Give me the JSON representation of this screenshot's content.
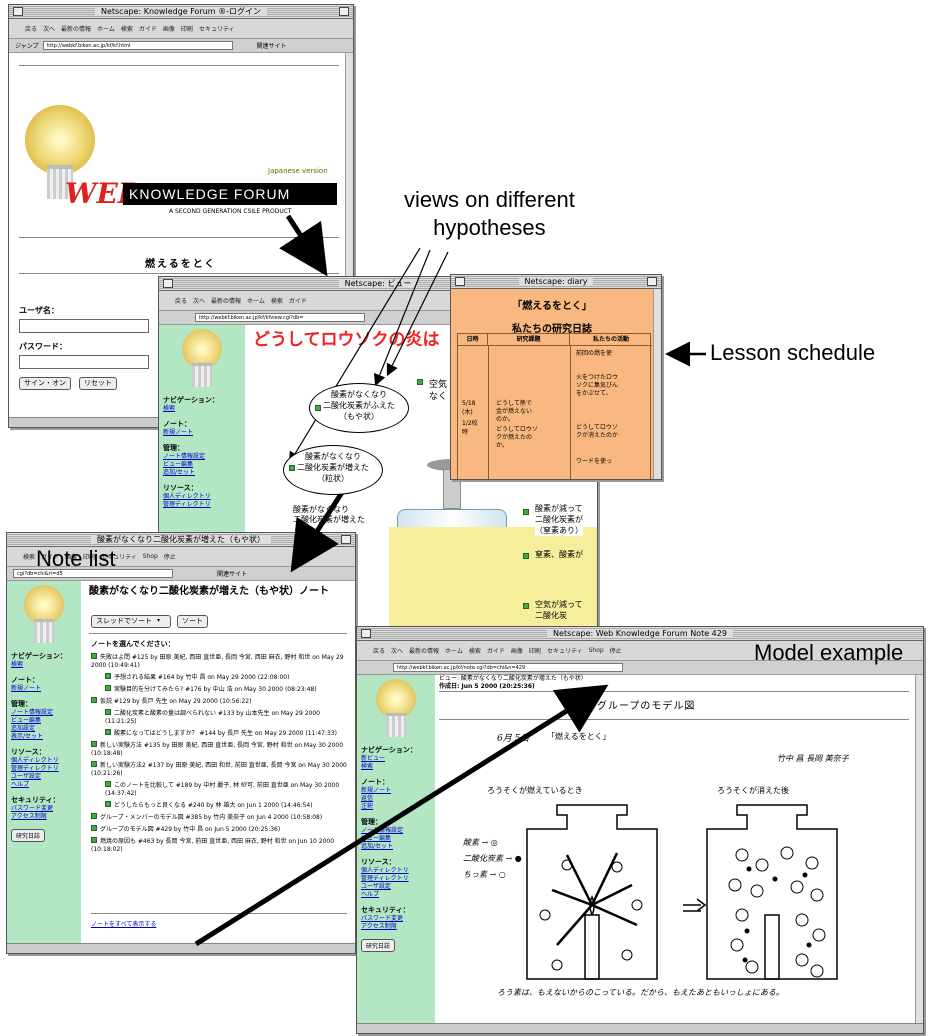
{
  "captions": {
    "views": "views on different\nhypotheses",
    "lesson": "Lesson schedule",
    "notelist": "Note list",
    "model": "Model example"
  },
  "login_window": {
    "title": "Netscape: Knowledge Forum ®-ログイン",
    "toolbar": [
      "戻る",
      "次へ",
      "最新の情報",
      "ホーム",
      "検索",
      "ガイド",
      "画像",
      "印刷",
      "セキュリティ"
    ],
    "location_label": "ジャンプ",
    "url": "http://webkf.biken.ac.jp/kf/kf.html",
    "related": "関連サイト",
    "version": "Japanese version",
    "brand_web": "WEB",
    "brand_kf": "KNOWLEDGE FORUM",
    "brand_sub": "A SECOND GENERATION CSILE PRODUCT",
    "database": "燃えるをとく",
    "user_label": "ユーザ名：",
    "password_label": "パスワード：",
    "signin_button": "サイン・オン",
    "reset_button": "リセット"
  },
  "view_window": {
    "title": "Netscape: ビュー",
    "url": "http://webkf.biken.ac.jp/kf/kfview.cgi?db=",
    "heading": "どうしてロウソクの炎は",
    "bubble1": "酸素がなくなり\n二酸化炭素がふえた\n（もや状）",
    "bubble2": "酸素がなくなり\n二酸化炭素が増えた\n（粒状）",
    "note3": "酸素がなくなり\n二酸化炭素が増えた",
    "note_right1": "空気",
    "note_right2": "なく",
    "note_right3": "酸素が減って\n二酸化炭素が\n（窒素あり）",
    "note_right4": "窒素、酸素が",
    "note_right5": "空気が減って\n二酸化炭",
    "nav_title": "ナビゲーション：",
    "nav_links": [
      "検索"
    ],
    "notes_title": "ノート：",
    "notes_links": [
      "新規ノート"
    ],
    "manage_title": "管理：",
    "manage_links": [
      "ノート情報設定",
      "ビュー編集",
      "追加/セット"
    ],
    "source_title": "リソース：",
    "source_links": [
      "個人ディレクトリ",
      "管理ディレクトリ"
    ]
  },
  "diary_window": {
    "title": "Netscape: diary",
    "heading1": "「燃えるをとく」",
    "heading2": "私たちの研究日誌",
    "col1": "日時",
    "col2": "研究課題",
    "col3": "私たちの活動",
    "date1": "5/18\n(木)",
    "date2": "1/2校\n時",
    "topic1": "どうして熱で\n金が燃えない\nのか。",
    "topic2": "どうしてロウソ\nクが燃えたの\nか。",
    "act1": "前回の燃を使",
    "act2": "火をつけたロウ\nソクに集気びん\nをかぶせて、",
    "act3": "どうしてロウソ\nクが消えたのか",
    "act4": "ワードを使っ"
  },
  "notelist_window": {
    "title": "酸素がなくなり二酸化炭素が増えた（もや状）",
    "url": "cgi?db=chi&ri=d5",
    "related": "関連サイト",
    "heading": "酸素がなくなり二酸化炭素が増えた（もや状）ノート",
    "select_value": "スレッドでソート",
    "sort_button": "ソート",
    "prompt": "ノートを選んでください：",
    "items": [
      "失敗はよ問 #125 by 田原 美紀, 西田 直世亜, 長岡 今宮, 西田 麻衣, 野村 和世 on May 29 2000 (10:49:41)",
      "予想される結果 #164 by 竹中 昌 on May 29 2000 (22:08:00)",
      "実験目的を分けてみたら? #176 by 中山 浩 on May 30 2000 (08:23:48)",
      "仮説 #129 by 長戸 先生 on May 29 2000 (10:56:22)",
      "二酸化炭素と酸素の量は調べられない #133 by 山本先生 on May 29 2000 (11:21:25)",
      "酸素になってはどうしますか？ #144 by 長戸 先生 on May 29 2000 (11:47:33)",
      "新しい実験方法 #135 by 田原 美紀, 西田 直世亜, 長岡 今宮, 野村 和世 on May 30 2000 (10:18:48)",
      "新しい実験方法2 #137 by 田原 美紀, 西田 和世, 前田 直世亜, 長岡 今宮 on May 30 2000 (10:21:26)",
      "このノートを比較して #189 by 中村 麗子, 林 紗可, 前田 直世亜 on May 30 2000 (14:37:42)",
      "どうしたらもっと良くなる #240 by 林 雄大 on Jun 1 2000 (14:46:54)",
      "グループ・メンバーのモデル図 #385 by 竹内 美奈子 on Jun 4 2000 (10:58:08)",
      "グループのモデル図 #429 by 竹中 昌 on Jun 5 2000 (20:25:36)",
      "燃焼の原因も #463 by 長岡 今宮, 前田 直世亜, 西田 麻衣, 野村 和世 on Jun 10 2000 (10:18:02)"
    ],
    "footer_link": "ノートをすべて表示する",
    "nav_title": "ナビゲーション：",
    "nav_links": [
      "検索"
    ],
    "notes_title": "ノート：",
    "notes_links": [
      "新規ノート"
    ],
    "manage_title": "管理：",
    "manage_links": [
      "ノート情報設定",
      "ビュー編集",
      "追加設定",
      "表示/セット"
    ],
    "source_title": "リソース：",
    "source_links": [
      "個人ディレクトリ",
      "管理ディレクトリ",
      "ユーザ設定",
      "ヘルプ"
    ],
    "sec_title": "セキュリティ：",
    "sec_links": [
      "パスワード変更",
      "アクセス制限"
    ],
    "diary_button": "研究日誌"
  },
  "model_window": {
    "title": "Netscape: Web Knowledge Forum Note 429",
    "toolbar": [
      "戻る",
      "次へ",
      "最新の情報",
      "ホーム",
      "検索",
      "ガイド",
      "画像",
      "印刷",
      "セキュリティ",
      "Shop",
      "停止"
    ],
    "url": "http://webkf.biken.ac.jp/kf/note.cgi?db=chi&n=429",
    "view_line": "ビュー: 酸素がなくなり二酸化炭素が増えた（もや状）",
    "created_line": "作成日: Jun 5 2000 (20:25:36)",
    "figure_title": "グループのモデル図",
    "sheet_date": "6月 5日",
    "sheet_title": "「燃えるをとく」",
    "sheet_names": "竹中 昌 長岡 美奈子",
    "label_left": "ろうそくが燃えているとき",
    "label_right": "ろうそくが消えた後",
    "legend": [
      "酸素 → ◎",
      "二酸化炭素 → ●",
      "ちっ素 → ○"
    ],
    "footnote": "ろう素は、もえないからのこっている。だから、もえたあともいっしょにある。",
    "nav_title": "ナビゲーション：",
    "nav_links": [
      "新ビュー",
      "検索"
    ],
    "notes_title": "ノート：",
    "notes_links": [
      "新規ノート",
      "返信",
      "注釈"
    ],
    "manage_title": "管理：",
    "manage_links": [
      "ノート情報設定",
      "ビュー編集",
      "追加/セット"
    ],
    "source_title": "リソース：",
    "source_links": [
      "個人ディレクトリ",
      "管理ディレクトリ",
      "ユーザ設定",
      "ヘルプ"
    ],
    "sec_title": "セキュリティ：",
    "sec_links": [
      "パスワード変更",
      "アクセス制限"
    ],
    "diary_button": "研究日誌"
  }
}
